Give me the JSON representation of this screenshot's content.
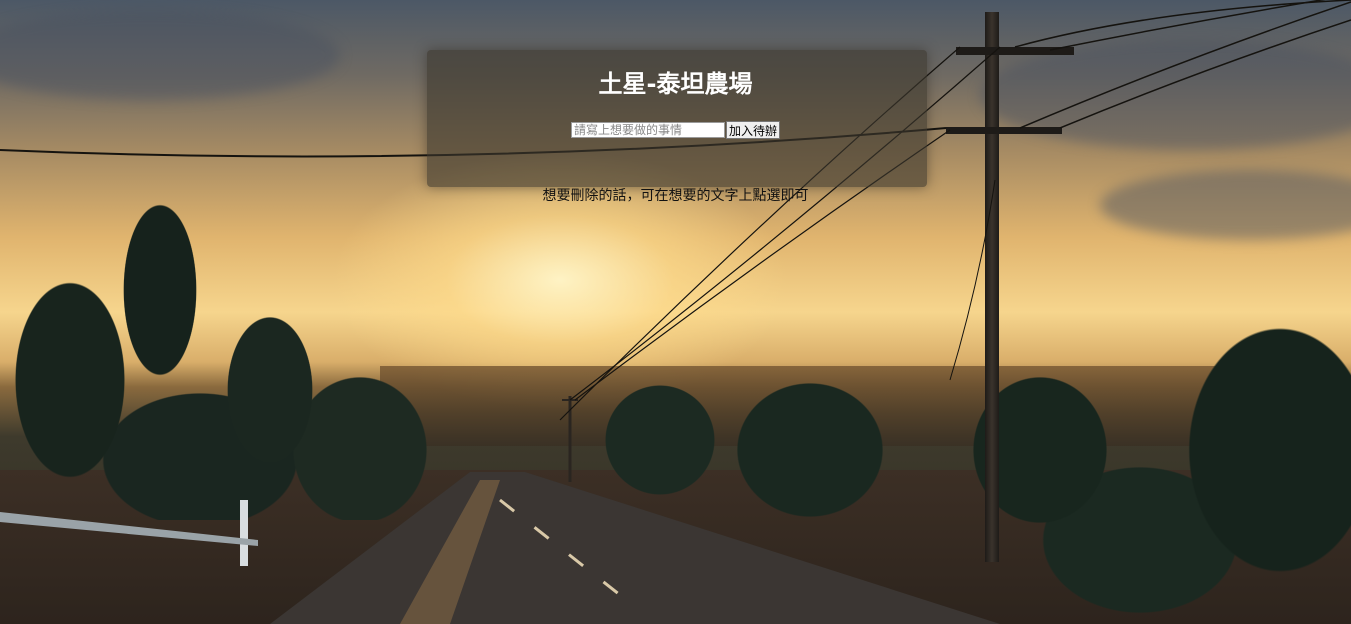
{
  "app": {
    "title": "土星-泰坦農場"
  },
  "todo_form": {
    "input_placeholder": "請寫上想要做的事情",
    "input_value": "",
    "add_button_label": "加入待辦"
  },
  "hint_text": "想要刪除的話，可在想要的文字上點選即可",
  "todo_items": [],
  "colors": {
    "panel_background": "#3c372d",
    "title_text": "#ffffff",
    "hint_text": "#111111"
  }
}
